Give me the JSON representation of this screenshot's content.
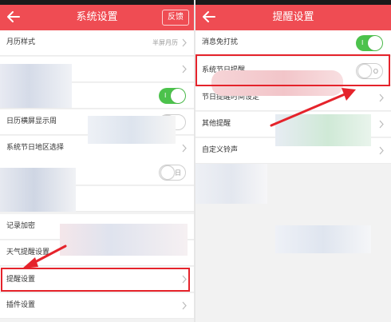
{
  "left": {
    "title": "系统设置",
    "feedback_label": "反馈",
    "rows": {
      "calendar_style": {
        "label": "月历样式",
        "value": "半屏月历"
      },
      "landscape_week": {
        "label": "日历横屏显示周"
      },
      "holiday_region": {
        "label": "系统节日地区选择"
      },
      "holiday_toggle": {
        "indicator": "周日"
      },
      "record_lock": {
        "label": "记录加密"
      },
      "weather_remind": {
        "label": "天气提醒设置"
      },
      "reminder_settings": {
        "label": "提醒设置"
      },
      "plugin_settings": {
        "label": "插件设置"
      }
    },
    "toggle_on_indicator": "I"
  },
  "right": {
    "title": "提醒设置",
    "rows": {
      "message_dnd": {
        "label": "消息免打扰",
        "state": "on",
        "indicator": "I"
      },
      "system_holiday_remind": {
        "label": "系统节日提醒",
        "state": "off",
        "indicator": "O"
      },
      "holiday_remind_time": {
        "label": "节日提醒时间设定"
      },
      "other_remind": {
        "label": "其他提醒"
      },
      "custom_ringtone": {
        "label": "自定义铃声"
      }
    }
  },
  "colors": {
    "header": "#ef4c53",
    "toggle_on": "#4cc24c",
    "highlight": "#e5232b"
  }
}
